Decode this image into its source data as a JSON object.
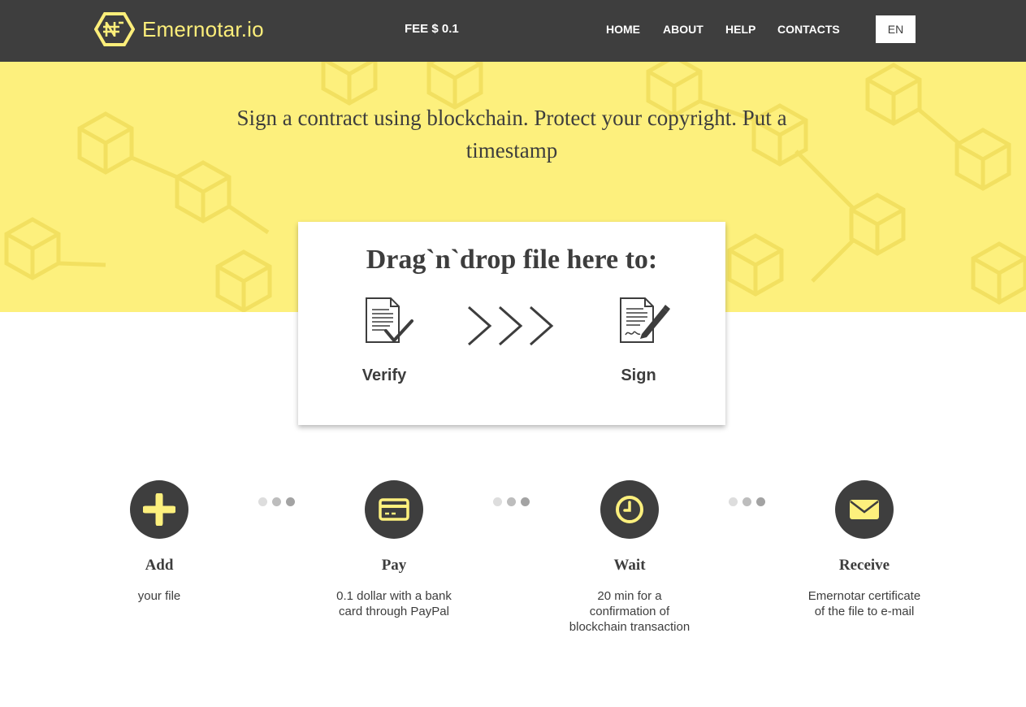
{
  "header": {
    "brand": "Emernotar.io",
    "fee": "FEE $ 0.1",
    "nav": [
      "HOME",
      "ABOUT",
      "HELP",
      "CONTACTS"
    ],
    "language": "EN"
  },
  "hero": {
    "tagline": "Sign a contract using blockchain. Protect your copyright. Put a timestamp"
  },
  "dropzone": {
    "title": "Drag`n`drop file here to:",
    "verify_label": "Verify",
    "sign_label": "Sign",
    "icons": [
      "document-check-icon",
      "chevrons-right-icon",
      "document-sign-icon"
    ]
  },
  "steps": [
    {
      "icon": "plus-icon",
      "title": "Add",
      "desc": "your file"
    },
    {
      "icon": "credit-card-icon",
      "title": "Pay",
      "desc": "0.1 dollar with a bank card through PayPal"
    },
    {
      "icon": "clock-icon",
      "title": "Wait",
      "desc": "20 min for a confirmation of blockchain transaction"
    },
    {
      "icon": "envelope-icon",
      "title": "Receive",
      "desc": "Emernotar certificate of the file to e-mail"
    }
  ],
  "colors": {
    "accent": "#fdf07d",
    "dark": "#3e3e3e",
    "dot_light": "#dddddd",
    "dot_mid": "#bdbdbd",
    "dot_dark": "#a3a3a3"
  }
}
